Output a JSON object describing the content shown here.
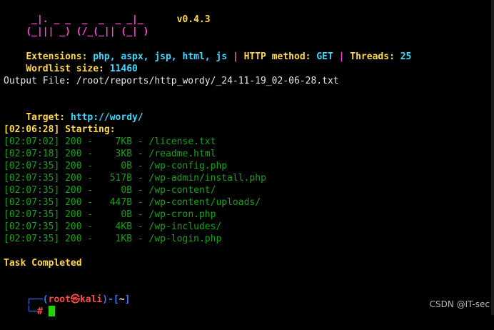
{
  "banner": {
    "logo_line1": " _|. _ _  _  _  _ _|_",
    "logo_line2": "(_||| _) (/_(_|| (_| )",
    "version": "v0.4.3"
  },
  "config": {
    "extensions_label": "Extensions:",
    "extensions_value": "php, aspx, jsp, html, js",
    "sep1": "|",
    "method_label": "HTTP method:",
    "method_value": "GET",
    "sep2": "|",
    "threads_label": "Threads:",
    "threads_value": "25",
    "wordlist_label": "Wordlist size:",
    "wordlist_value": "11460"
  },
  "output_file": "Output File: /root/reports/http_wordy/_24-11-19_02-06-28.txt",
  "target": {
    "label": "Target:",
    "value": "http://wordy/"
  },
  "starting": "[02:06:28] Starting:",
  "results": [
    {
      "time": "[02:07:02]",
      "status": "200",
      "size": "   7KB",
      "path": "/license.txt"
    },
    {
      "time": "[02:07:18]",
      "status": "200",
      "size": "   3KB",
      "path": "/readme.html"
    },
    {
      "time": "[02:07:35]",
      "status": "200",
      "size": "    0B",
      "path": "/wp-config.php"
    },
    {
      "time": "[02:07:35]",
      "status": "200",
      "size": "  517B",
      "path": "/wp-admin/install.php"
    },
    {
      "time": "[02:07:35]",
      "status": "200",
      "size": "    0B",
      "path": "/wp-content/"
    },
    {
      "time": "[02:07:35]",
      "status": "200",
      "size": "  447B",
      "path": "/wp-content/uploads/"
    },
    {
      "time": "[02:07:35]",
      "status": "200",
      "size": "    0B",
      "path": "/wp-cron.php"
    },
    {
      "time": "[02:07:35]",
      "status": "200",
      "size": "   4KB",
      "path": "/wp-includes/"
    },
    {
      "time": "[02:07:35]",
      "status": "200",
      "size": "   1KB",
      "path": "/wp-login.php"
    }
  ],
  "completed": "Task Completed",
  "prompt": {
    "open": "┌──(",
    "user": "root",
    "at": "㉿",
    "host": "kali",
    "close_mid": ")-[",
    "dir": "~",
    "close": "]",
    "line2_prefix": "└─",
    "hash": "#"
  },
  "watermark": "CSDN @IT-sec"
}
